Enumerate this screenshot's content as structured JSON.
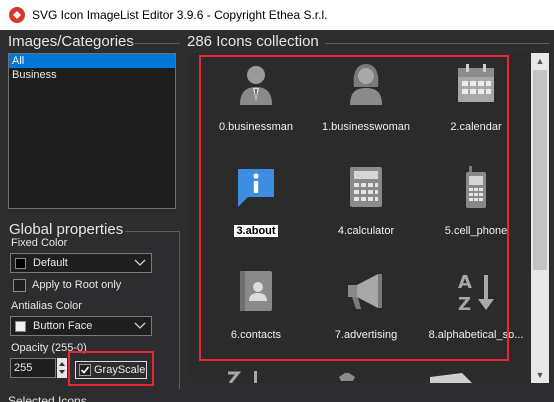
{
  "window": {
    "title": "SVG Icon ImageList Editor 3.9.6 - Copyright Ethea S.r.l.",
    "app_icon": "svg-app-icon"
  },
  "categories": {
    "title": "Images/Categories",
    "items": [
      {
        "label": "All",
        "selected": true
      },
      {
        "label": "Business",
        "selected": false
      }
    ]
  },
  "global": {
    "title": "Global properties",
    "fixed_color_label": "Fixed Color",
    "fixed_color_value": "Default",
    "fixed_color_swatch": "#000000",
    "apply_root_label": "Apply to Root only",
    "antialias_label": "Antialias Color",
    "antialias_value": "Button Face",
    "antialias_swatch": "#f0f0f0",
    "opacity_label": "Opacity (255-0)",
    "opacity_value": "255",
    "grayscale_label": "GrayScale",
    "grayscale_checked": true
  },
  "collection": {
    "title": "286 Icons collection",
    "icons": [
      {
        "label": "0.businessman",
        "icon": "businessman-icon"
      },
      {
        "label": "1.businesswoman",
        "icon": "businesswoman-icon"
      },
      {
        "label": "2.calendar",
        "icon": "calendar-icon"
      },
      {
        "label": "3.about",
        "icon": "about-icon",
        "selected": true
      },
      {
        "label": "4.calculator",
        "icon": "calculator-icon"
      },
      {
        "label": "5.cell_phone",
        "icon": "cell-phone-icon"
      },
      {
        "label": "6.contacts",
        "icon": "contacts-icon"
      },
      {
        "label": "7.advertising",
        "icon": "advertising-icon"
      },
      {
        "label": "8.alphabetical_so...",
        "icon": "alphabetical-sort-icon"
      }
    ]
  },
  "bottom": {
    "label": "Selected Icons"
  },
  "colors": {
    "accent": "#0078d7",
    "highlight": "#e8262f",
    "icon_gray": "#9a9a9a",
    "about_blue": "#3d8ee0"
  }
}
